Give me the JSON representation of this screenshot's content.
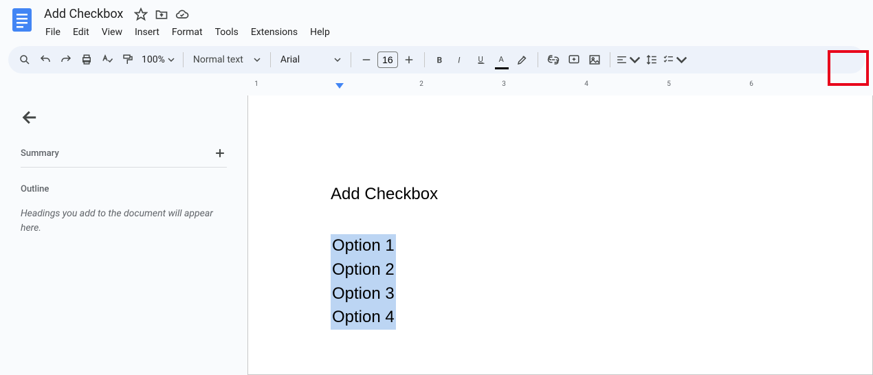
{
  "header": {
    "doc_title": "Add Checkbox",
    "menus": [
      "File",
      "Edit",
      "View",
      "Insert",
      "Format",
      "Tools",
      "Extensions",
      "Help"
    ]
  },
  "toolbar": {
    "zoom": "100%",
    "paragraph_style": "Normal text",
    "font_family": "Arial",
    "font_size": "16"
  },
  "sidebar": {
    "summary_label": "Summary",
    "outline_label": "Outline",
    "outline_empty": "Headings you add to the document will appear here."
  },
  "document": {
    "heading": "Add Checkbox",
    "options": [
      "Option 1",
      "Option 2",
      "Option 3",
      "Option 4"
    ]
  },
  "ruler": {
    "labels": [
      "1",
      "2",
      "3",
      "4",
      "5",
      "6"
    ]
  }
}
